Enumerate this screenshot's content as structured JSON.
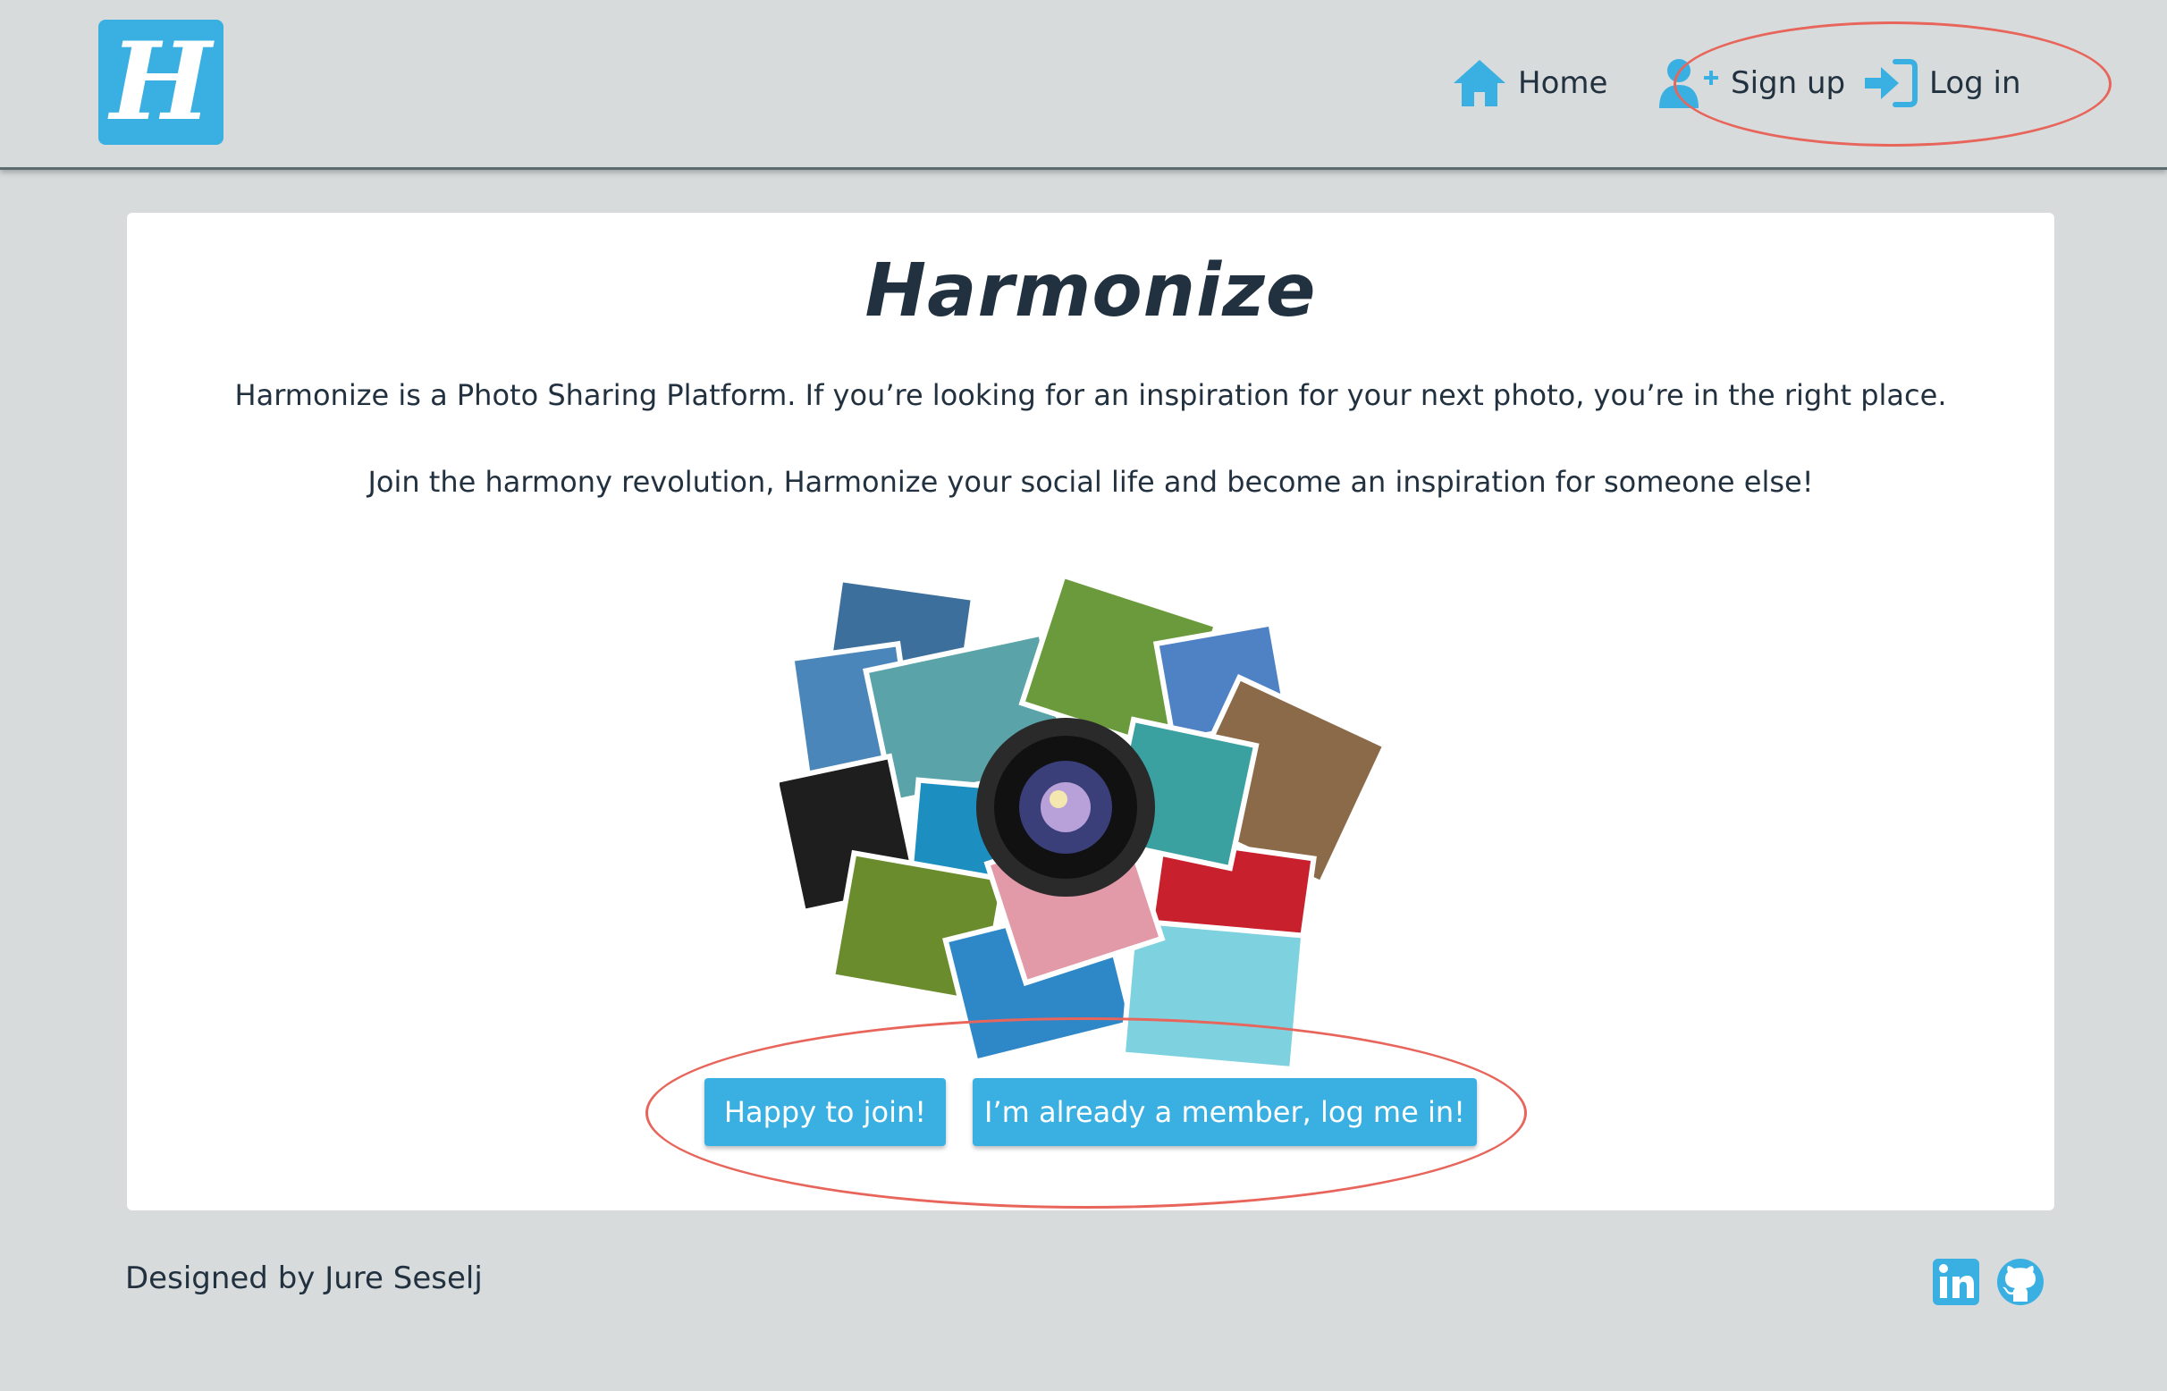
{
  "brand": {
    "logo_letter": "H"
  },
  "nav": {
    "home_label": "Home",
    "signup_label": "Sign up",
    "login_label": "Log in"
  },
  "main": {
    "title": "Harmonize",
    "paragraph1": "Harmonize is a Photo Sharing Platform. If you’re looking for an inspiration for your next photo, you’re in the right place.",
    "paragraph2": "Join the harmony revolution, Harmonize your social life and become an inspiration for someone else!",
    "join_button": "Happy to join!",
    "login_button": "I’m already a member, log me in!"
  },
  "footer": {
    "credit": "Designed by Jure Seselj",
    "social": [
      "linkedin-icon",
      "github-icon"
    ]
  },
  "colors": {
    "accent": "#3ab0e2",
    "background": "#d7dbdb",
    "text": "#22313f",
    "annotation": "#e8655b"
  }
}
